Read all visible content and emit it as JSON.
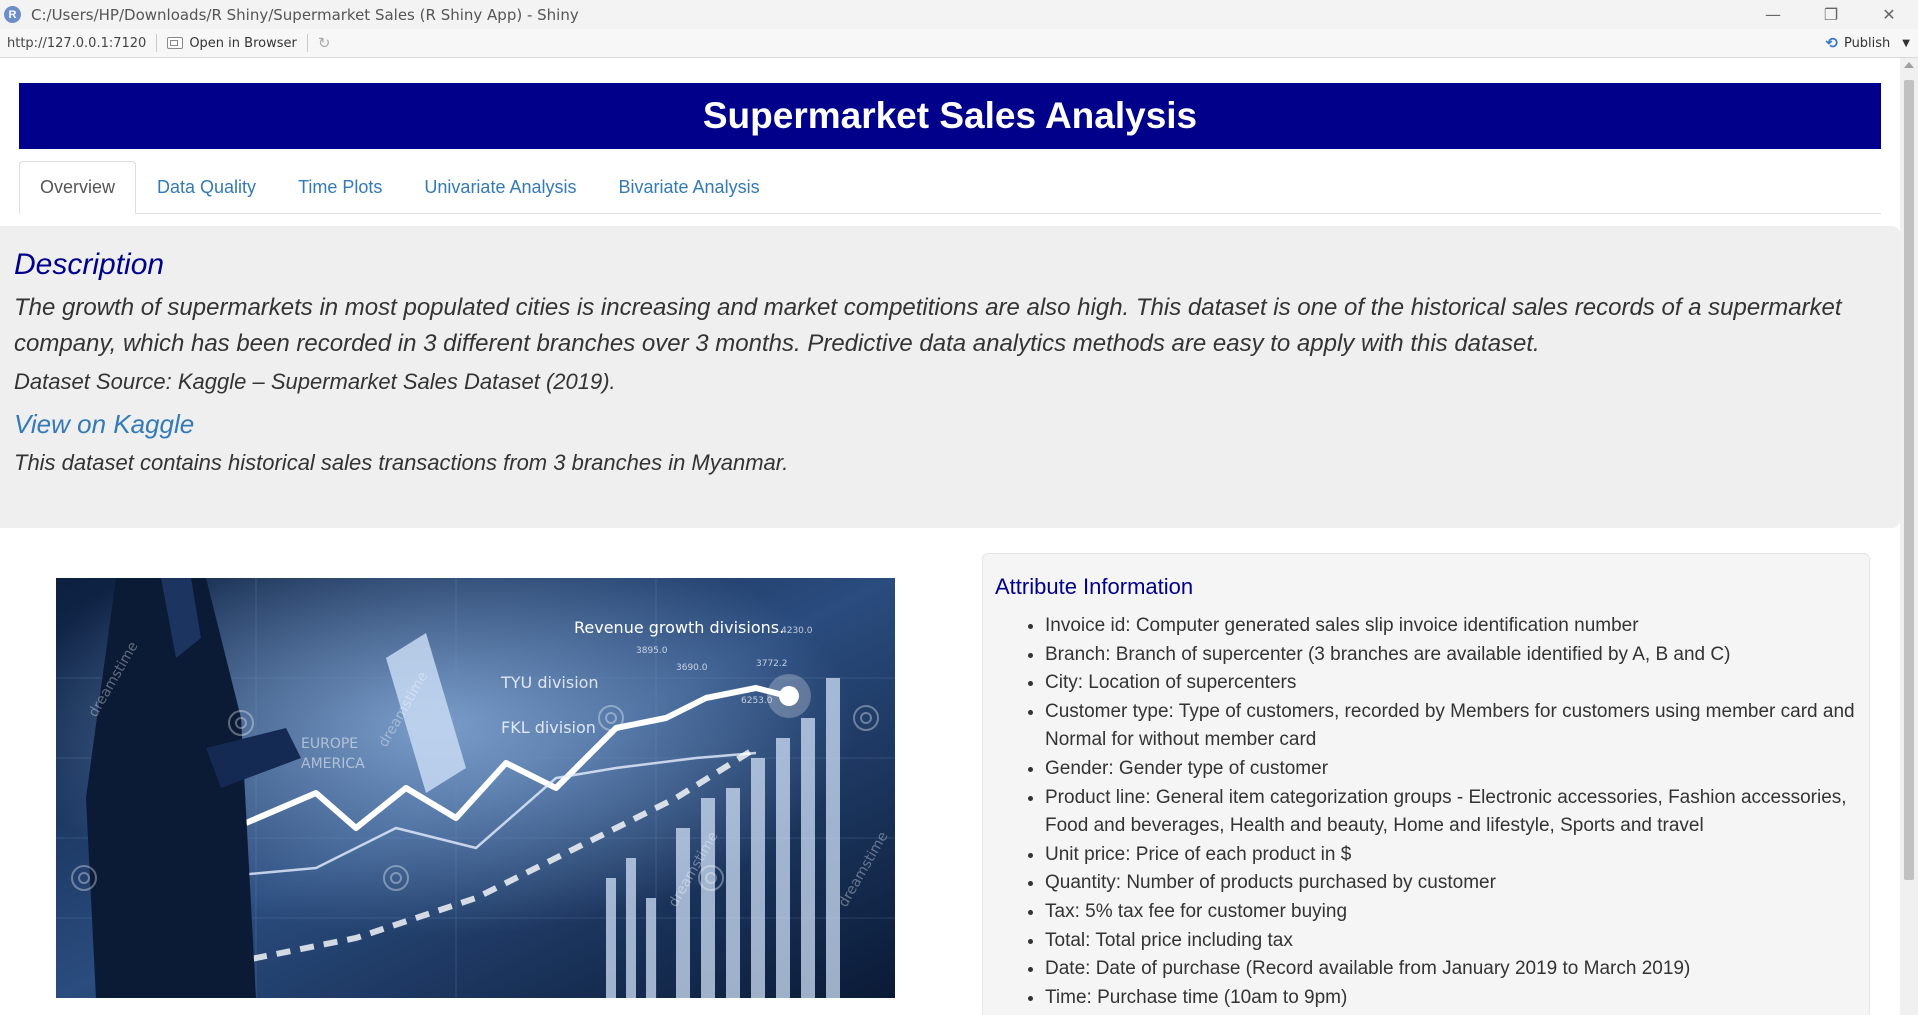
{
  "window": {
    "title": "C:/Users/HP/Downloads/R Shiny/Supermarket Sales (R Shiny App) - Shiny",
    "app_icon_letter": "R",
    "minimize": "—",
    "restore": "❐",
    "close": "✕"
  },
  "toolbar": {
    "url": "http://127.0.0.1:7120",
    "open_in_browser": "Open in Browser",
    "publish": "Publish"
  },
  "header": {
    "title": "Supermarket Sales Analysis"
  },
  "tabs": [
    {
      "label": "Overview",
      "active": true
    },
    {
      "label": "Data Quality",
      "active": false
    },
    {
      "label": "Time Plots",
      "active": false
    },
    {
      "label": "Univariate Analysis",
      "active": false
    },
    {
      "label": "Bivariate Analysis",
      "active": false
    }
  ],
  "description": {
    "heading": "Description",
    "paragraph": "The growth of supermarkets in most populated cities is increasing and market competitions are also high. This dataset is one of the historical sales records of a supermarket company, which has been recorded in 3 different branches over 3 months. Predictive data analytics methods are easy to apply with this dataset.",
    "source": "Dataset Source: Kaggle – Supermarket Sales Dataset (2019).",
    "link_label": "View on Kaggle",
    "note": "This dataset contains historical sales transactions from 3 branches in Myanmar."
  },
  "image": {
    "caption_text": "Revenue growth divisions.",
    "label_1": "TYU division",
    "label_2": "FKL division",
    "label_3": "EUROPE",
    "label_4": "AMERICA",
    "watermark": "dreamstime",
    "numbers": [
      "3690.0",
      "3772.2",
      "4230.0",
      "6253.0",
      "3895.0"
    ]
  },
  "attributes": {
    "heading": "Attribute Information",
    "items": [
      "Invoice id: Computer generated sales slip invoice identification number",
      "Branch: Branch of supercenter (3 branches are available identified by A, B and C)",
      "City: Location of supercenters",
      "Customer type: Type of customers, recorded by Members for customers using member card and Normal for without member card",
      "Gender: Gender type of customer",
      "Product line: General item categorization groups - Electronic accessories, Fashion accessories, Food and beverages, Health and beauty, Home and lifestyle, Sports and travel",
      "Unit price: Price of each product in $",
      "Quantity: Number of products purchased by customer",
      "Tax: 5% tax fee for customer buying",
      "Total: Total price including tax",
      "Date: Date of purchase (Record available from January 2019 to March 2019)",
      "Time: Purchase time (10am to 9pm)"
    ]
  }
}
